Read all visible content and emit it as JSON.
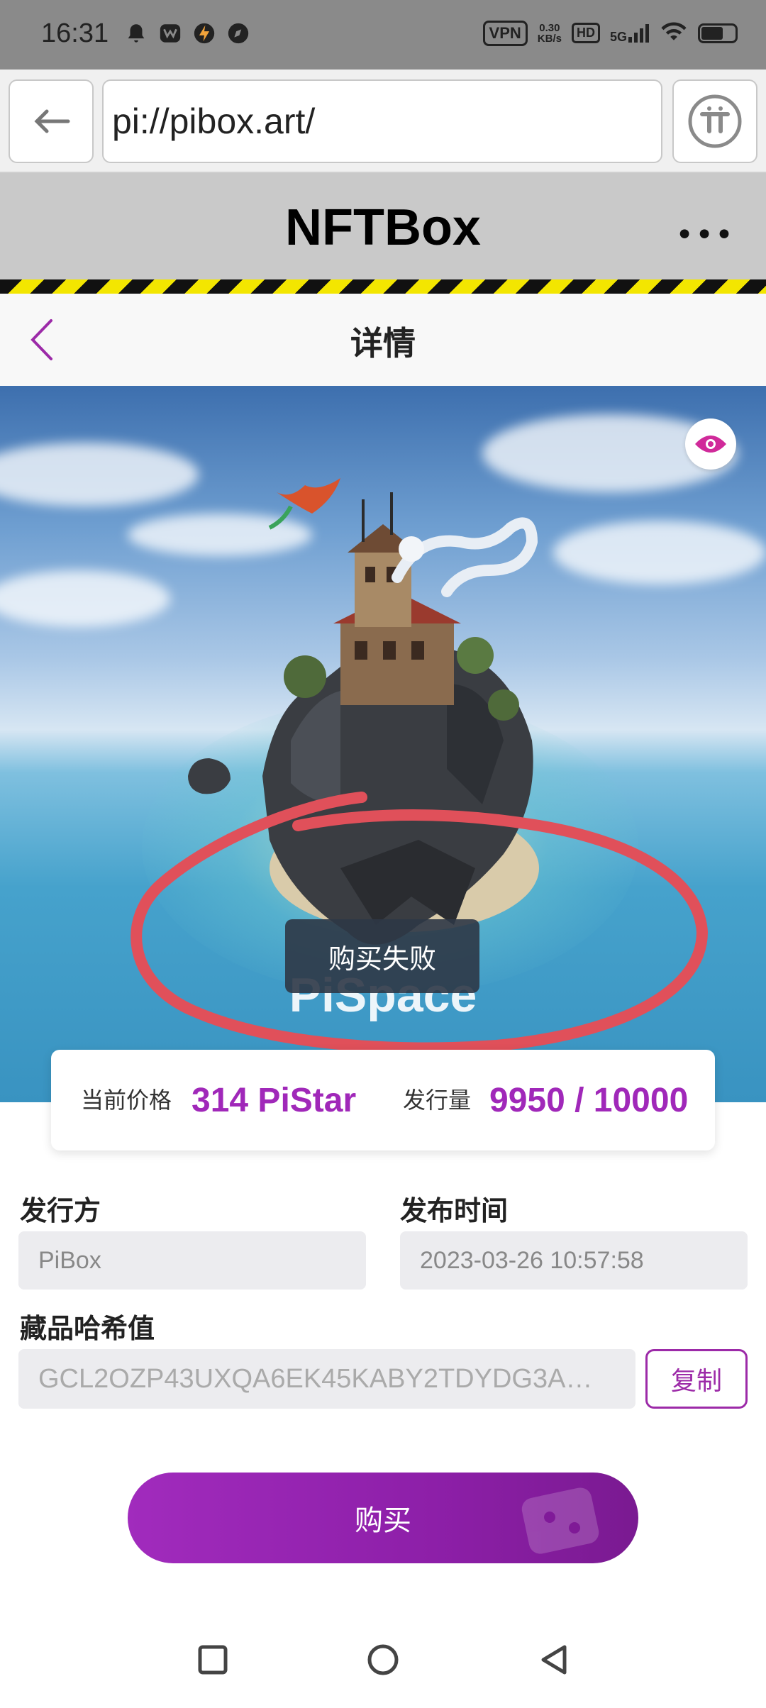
{
  "status_bar": {
    "time": "16:31",
    "vpn": "VPN",
    "speed_top": "0.30",
    "speed_unit": "KB/s",
    "hd": "HD",
    "network": "5G",
    "icons": [
      "bell-icon",
      "app-icon",
      "lightning-icon",
      "compass-icon",
      "signal-icon",
      "wifi-icon",
      "battery-icon"
    ]
  },
  "browser": {
    "url": "pi://pibox.art/",
    "back_icon": "arrow-left-icon",
    "pi_icon": "pi-logo-icon"
  },
  "app": {
    "title": "NFTBox",
    "more": "•••"
  },
  "page": {
    "title": "详情"
  },
  "hero": {
    "name": "PiSpace",
    "toast": "购买失败"
  },
  "price_card": {
    "price_label": "当前价格",
    "price_value": "314 PiStar",
    "supply_label": "发行量",
    "supply_value": "9950 / 10000"
  },
  "details": {
    "issuer_label": "发行方",
    "issuer_value": "PiBox",
    "release_label": "发布时间",
    "release_value": "2023-03-26 10:57:58",
    "hash_label": "藏品哈希值",
    "hash_value": "GCL2OZP43UXQA6EK45KABY2TDYDG3A…",
    "copy_label": "复制"
  },
  "buy_button": {
    "label": "购买"
  },
  "colors": {
    "accent": "#a028b9",
    "hazard_yellow": "#f3e600",
    "annotation_red": "#e0505a"
  }
}
